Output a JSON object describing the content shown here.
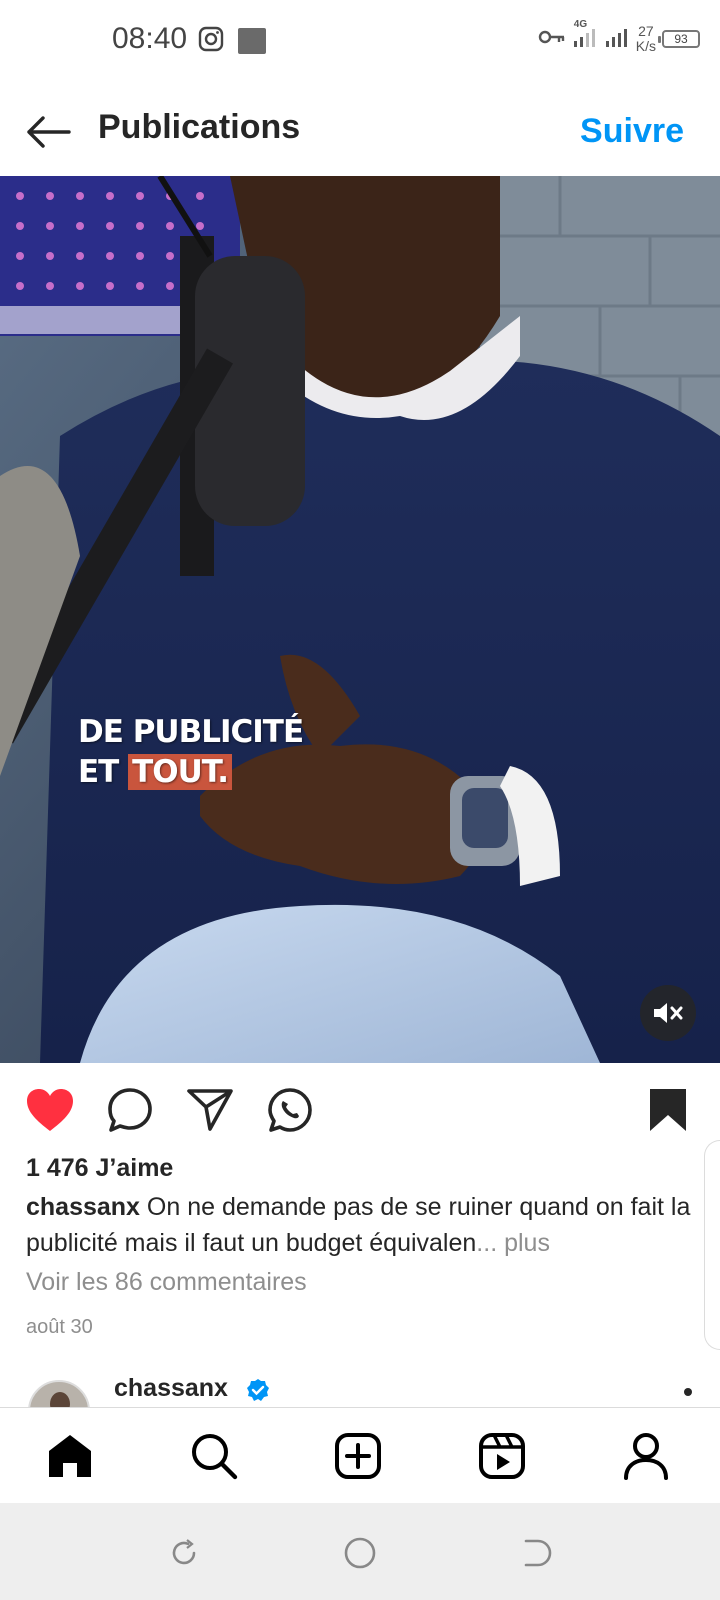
{
  "status_bar": {
    "time": "08:40",
    "network": "4G",
    "speed_value": "27",
    "speed_unit": "K/s",
    "battery": "93"
  },
  "header": {
    "title": "Publications",
    "follow_label": "Suivre"
  },
  "media": {
    "overlay_line1": "DE PUBLICITÉ",
    "overlay_line2_a": "ET ",
    "overlay_line2_b": "TOUT.",
    "muted": true
  },
  "post": {
    "likes": "1 476 J’aime",
    "username": "chassanx",
    "caption": " On ne demande pas de se ruiner quand on fait la publicité mais il faut un budget équivalen",
    "more": "... plus",
    "view_comments": "Voir les 86 commentaires",
    "date": "août 30",
    "liked": true,
    "saved": true
  },
  "next_post": {
    "username": "chassanx",
    "verified": true
  },
  "icons": {
    "like": "heart-icon",
    "comment": "comment-icon",
    "share": "send-icon",
    "whatsapp": "whatsapp-icon",
    "save": "bookmark-icon",
    "mute": "speaker-muted-icon"
  },
  "colors": {
    "accent": "#0095f6",
    "like": "#ff3040",
    "text": "#262626",
    "secondary": "#8e8e8e"
  }
}
